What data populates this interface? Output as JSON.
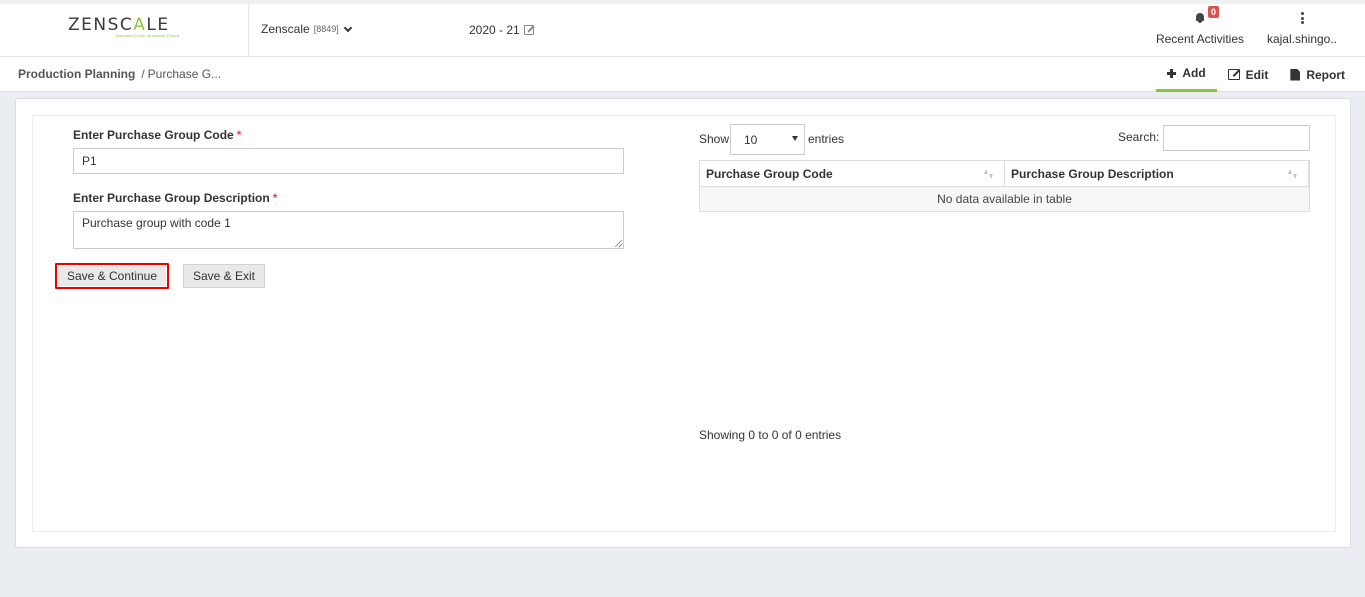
{
  "header": {
    "logo_text_a": "ZENSC",
    "logo_text_accent": "A",
    "logo_text_b": "LE",
    "logo_tagline": "Business Ease. Business Peace.",
    "company_name": "Zenscale",
    "company_code": "[8849]",
    "fiscal_year": "2020 - 21",
    "recent_activities_label": "Recent Activities",
    "notification_count": "0",
    "username": "kajal.shingo.."
  },
  "breadcrumb": {
    "module": "Production Planning",
    "separator": "/",
    "page": "Purchase G..."
  },
  "toolbar": {
    "add_label": "Add",
    "edit_label": "Edit",
    "report_label": "Report"
  },
  "form": {
    "code_label": "Enter Purchase Group Code",
    "code_required": "*",
    "code_value": "P1",
    "description_label": "Enter Purchase Group Description",
    "description_required": "*",
    "description_value": "Purchase group with code 1",
    "save_continue_label": "Save & Continue",
    "save_exit_label": "Save & Exit"
  },
  "table": {
    "show_label": "Show",
    "page_size": "10",
    "entries_label": "entries",
    "search_label": "Search:",
    "search_value": "",
    "columns": [
      "Purchase Group Code",
      "Purchase Group Description"
    ],
    "empty_message": "No data available in table",
    "info": "Showing 0 to 0 of 0 entries"
  },
  "colors": {
    "accent": "#8cc63f",
    "required": "#d9534f",
    "highlight": "#e00000"
  }
}
